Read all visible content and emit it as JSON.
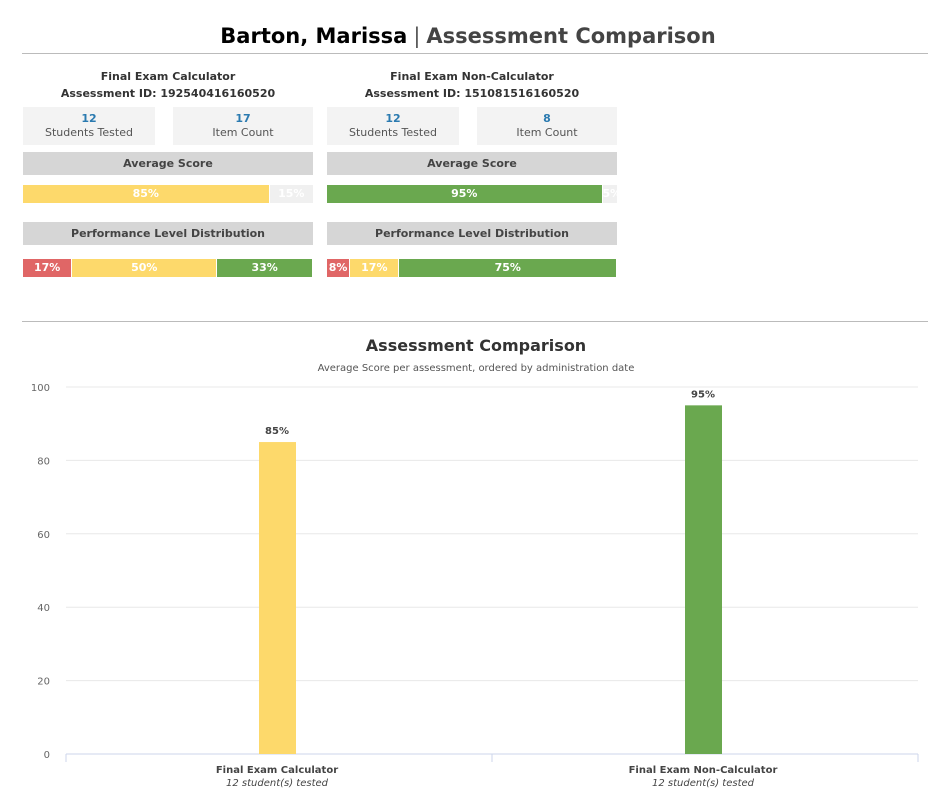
{
  "header": {
    "student_name": "Barton, Marissa",
    "separator": "|",
    "page_title": "Assessment Comparison"
  },
  "assessments": [
    {
      "name": "Final Exam Calculator",
      "id_label": "Assessment ID: 192540416160520",
      "students_tested": "12",
      "students_tested_label": "Students Tested",
      "item_count": "17",
      "item_count_label": "Item Count",
      "average_score_label": "Average Score",
      "average_score": {
        "value": 85,
        "label": "85%",
        "remainder_label": "15%",
        "color": "#fdd96b"
      },
      "distribution_label": "Performance Level Distribution",
      "distribution": [
        {
          "value": 17,
          "label": "17%",
          "color": "#e06666"
        },
        {
          "value": 50,
          "label": "50%",
          "color": "#fdd96b"
        },
        {
          "value": 33,
          "label": "33%",
          "color": "#6aa84f"
        }
      ]
    },
    {
      "name": "Final Exam Non-Calculator",
      "id_label": "Assessment ID: 151081516160520",
      "students_tested": "12",
      "students_tested_label": "Students Tested",
      "item_count": "8",
      "item_count_label": "Item Count",
      "average_score_label": "Average Score",
      "average_score": {
        "value": 95,
        "label": "95%",
        "remainder_label": "5%",
        "color": "#6aa84f"
      },
      "distribution_label": "Performance Level Distribution",
      "distribution": [
        {
          "value": 8,
          "label": "8%",
          "color": "#e06666"
        },
        {
          "value": 17,
          "label": "17%",
          "color": "#fdd96b"
        },
        {
          "value": 75,
          "label": "75%",
          "color": "#6aa84f"
        }
      ]
    }
  ],
  "chart_data": {
    "type": "bar",
    "title": "Assessment Comparison",
    "subtitle": "Average Score per assessment, ordered by administration date",
    "categories": [
      "Final Exam Calculator",
      "Final Exam Non-Calculator"
    ],
    "category_sublabels": [
      "12 student(s) tested",
      "12 student(s) tested"
    ],
    "values": [
      85,
      95
    ],
    "data_labels": [
      "85%",
      "95%"
    ],
    "colors": [
      "#fdd96b",
      "#6aa84f"
    ],
    "ylim": [
      0,
      100
    ],
    "yticks": [
      0,
      20,
      40,
      60,
      80,
      100
    ],
    "grid": true,
    "xlabel": "",
    "ylabel": ""
  }
}
